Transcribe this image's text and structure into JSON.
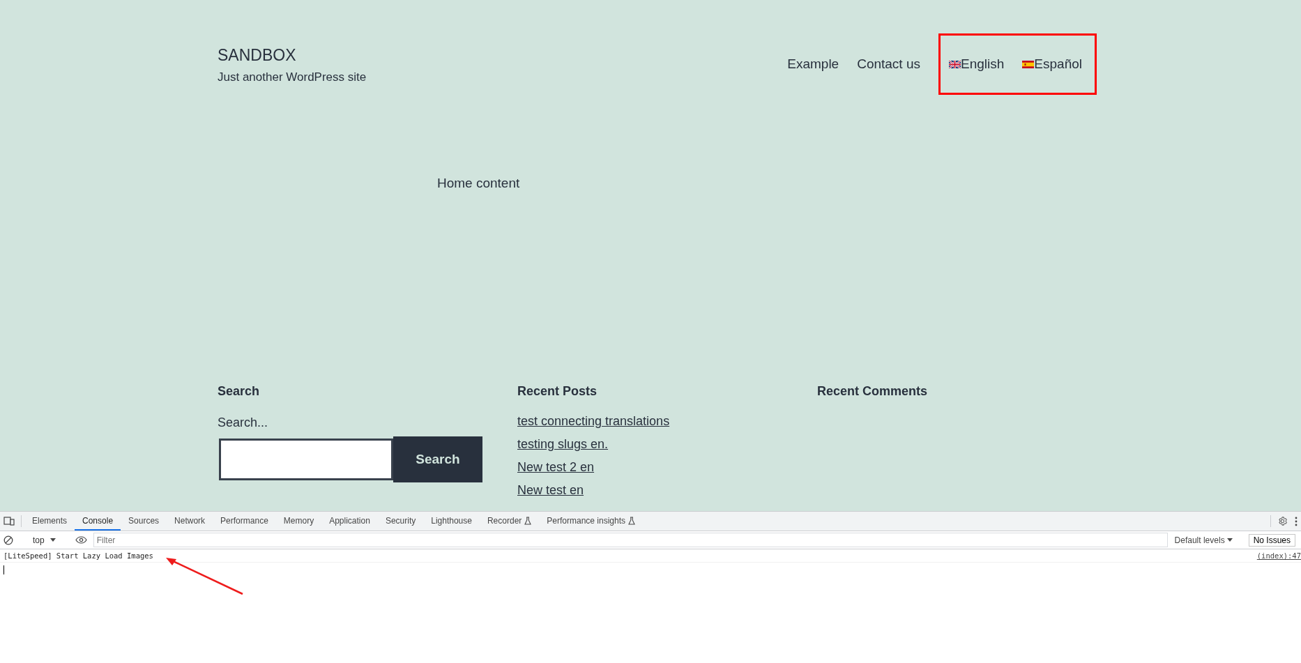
{
  "site": {
    "title": "SANDBOX",
    "tagline": "Just another WordPress site"
  },
  "nav": {
    "items": [
      "Example",
      "Contact us"
    ],
    "languages": [
      {
        "label": "English",
        "kind": "uk"
      },
      {
        "label": "Español",
        "kind": "es"
      }
    ],
    "highlighted": true
  },
  "content": "Home content",
  "widgets": {
    "search": {
      "heading": "Search",
      "label": "Search...",
      "button": "Search"
    },
    "recent_posts": {
      "heading": "Recent Posts",
      "items": [
        "test connecting translations",
        "testing slugs en.",
        "New test 2 en",
        "New test en"
      ]
    },
    "recent_comments": {
      "heading": "Recent Comments"
    }
  },
  "devtools": {
    "tabs": [
      {
        "label": "Elements",
        "selected": false,
        "experimental": false
      },
      {
        "label": "Console",
        "selected": true,
        "experimental": false
      },
      {
        "label": "Sources",
        "selected": false,
        "experimental": false
      },
      {
        "label": "Network",
        "selected": false,
        "experimental": false
      },
      {
        "label": "Performance",
        "selected": false,
        "experimental": false
      },
      {
        "label": "Memory",
        "selected": false,
        "experimental": false
      },
      {
        "label": "Application",
        "selected": false,
        "experimental": false
      },
      {
        "label": "Security",
        "selected": false,
        "experimental": false
      },
      {
        "label": "Lighthouse",
        "selected": false,
        "experimental": false
      },
      {
        "label": "Recorder",
        "selected": false,
        "experimental": true
      },
      {
        "label": "Performance insights",
        "selected": false,
        "experimental": true
      }
    ],
    "context": "top",
    "filter_placeholder": "Filter",
    "levels": "Default levels",
    "issues": "No Issues",
    "messages": [
      {
        "text": "[LiteSpeed] Start Lazy Load Images",
        "source": "(index):47"
      }
    ]
  }
}
